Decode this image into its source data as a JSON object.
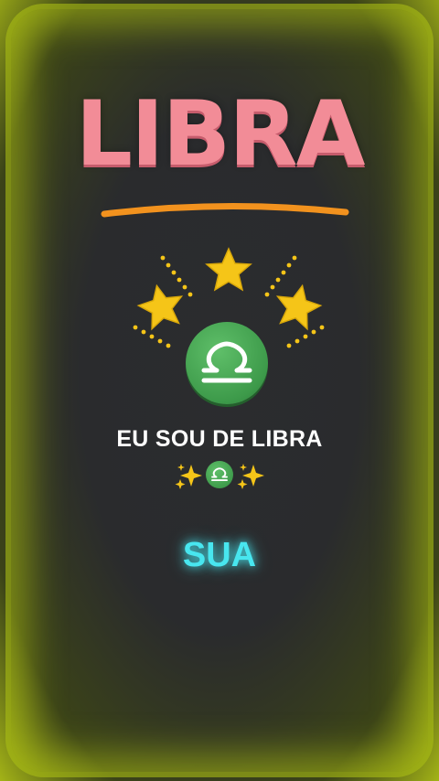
{
  "card": {
    "title": "LIBRA",
    "caption": "EU SOU DE LIBRA",
    "highlight_word": "SUA"
  },
  "icons": {
    "zodiac": "libra-sign-icon",
    "sparkles": "sparkles-icon",
    "stars": "star-icon"
  },
  "colors": {
    "title": "#f28c97",
    "underline": "#f2921e",
    "star": "#f5c518",
    "badge": "#3d9a4a",
    "highlight": "#48e6ef",
    "frame_glow": "#a3b317"
  }
}
